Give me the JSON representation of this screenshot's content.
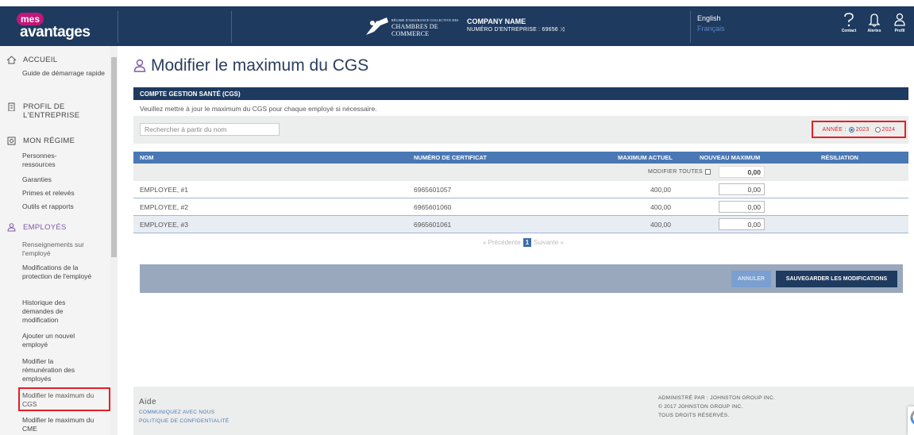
{
  "brand": {
    "mes": "mes",
    "avantages": "avantages"
  },
  "chamber": {
    "line1": "RÉGIME D'ASSURANCE COLLECTIVE DES",
    "line2": "CHAMBRES DE COMMERCE"
  },
  "company": {
    "name": "COMPANY NAME",
    "number": "NUMÉRO D'ENTREPRISE : 69656 ⤨"
  },
  "language": {
    "current": "English",
    "alternate": "Français"
  },
  "top_icons": [
    {
      "icon": "help-icon",
      "label": "Contact"
    },
    {
      "icon": "bell-icon",
      "label": "Alertes"
    },
    {
      "icon": "profile-icon",
      "label": "Profil"
    }
  ],
  "sidebar": {
    "accueil": "ACCUEIL",
    "guide": "Guide de démarrage rapide",
    "profil": "PROFIL DE L'ENTREPRISE",
    "regime": "MON RÉGIME",
    "regime_items": [
      "Personnes-ressources",
      "Garanties",
      "Primes et relevés",
      "Outils et rapports"
    ],
    "employes": "EMPLOYÉS",
    "employes_items": [
      "Renseignements sur l'employé",
      "Modifications de la protection de l'employé",
      "Historique des demandes de modification",
      "Ajouter un nouvel employé",
      "Modifier la rémunération des employés",
      "Modifier le maximum du CGS",
      "Modifier le maximum du CME"
    ]
  },
  "page": {
    "title": "Modifier le maximum du CGS"
  },
  "section": {
    "header": "COMPTE GESTION SANTÉ (CGS)",
    "description": "Veuillez mettre à jour le maximum du CGS pour chaque employé si nécessaire."
  },
  "search": {
    "placeholder": "Rechercher à partir du nom"
  },
  "year": {
    "label": "ANNÉE :",
    "options": [
      "2023",
      "2024"
    ],
    "selected": "2023"
  },
  "table": {
    "headers": [
      "NOM",
      "NUMÉRO DE CERTIFICAT",
      "MAXIMUM ACTUEL",
      "NOUVEAU MAXIMUM",
      "RÉSILIATION"
    ],
    "edit_all_label": "MODIFIER TOUTES",
    "edit_all_value": "0,00",
    "rows": [
      {
        "name": "EMPLOYEE, #1",
        "certificate": "6965601057",
        "current": "400,00",
        "new": "0,00"
      },
      {
        "name": "EMPLOYEE, #2",
        "certificate": "6965601060",
        "current": "400,00",
        "new": "0,00"
      },
      {
        "name": "EMPLOYEE, #3",
        "certificate": "6965601061",
        "current": "400,00",
        "new": "0,00"
      }
    ]
  },
  "pagination": {
    "prev": "« Précédente",
    "current": "1",
    "next": "Suivante »"
  },
  "actions": {
    "cancel": "ANNULER",
    "save": "SAUVEGARDER LES MODIFICATIONS"
  },
  "footer": {
    "aide": "Aide",
    "contact": "COMMUNIQUEZ AVEC NOUS",
    "privacy": "POLITIQUE DE CONFIDENTIALITÉ",
    "admin": "ADMINISTRÉ PAR : JOHNSTON GROUP INC.",
    "copyright": "© 2017 JOHNSTON GROUP INC.",
    "rights": "TOUS DROITS RÉSERVÉS."
  },
  "colors": {
    "navy": "#1e3a5f",
    "header_blue": "#4a78b4",
    "accent_purple": "#7f57a6",
    "highlight_red": "#e51e24",
    "brand_pink": "#c2187a"
  }
}
